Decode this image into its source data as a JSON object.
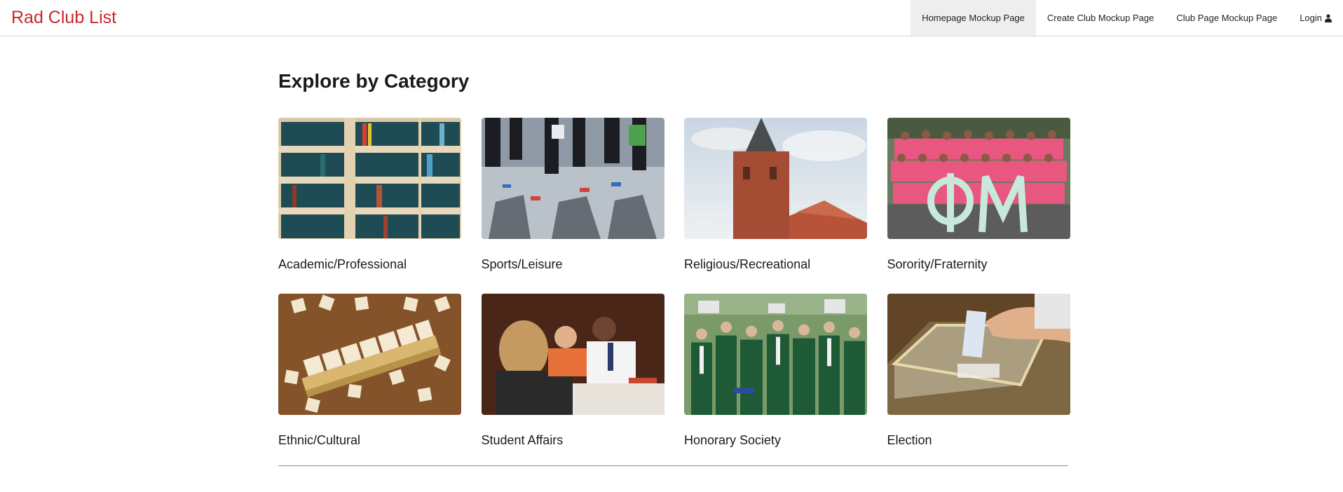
{
  "app": {
    "brand": "Rad Club List",
    "brand_color": "#c8282a"
  },
  "nav": {
    "items": [
      {
        "label": "Homepage Mockup Page",
        "active": true
      },
      {
        "label": "Create Club Mockup Page",
        "active": false
      },
      {
        "label": "Club Page Mockup Page",
        "active": false
      },
      {
        "label": "Login",
        "active": false,
        "icon": "user-icon"
      }
    ]
  },
  "main": {
    "title": "Explore by Category",
    "categories": [
      {
        "label": "Academic/Professional",
        "image": "bookshelf-photo"
      },
      {
        "label": "Sports/Leisure",
        "image": "runners-photo"
      },
      {
        "label": "Religious/Recreational",
        "image": "church-tower-photo"
      },
      {
        "label": "Sorority/Fraternity",
        "image": "sorority-group-photo"
      },
      {
        "label": "Ethnic/Cultural",
        "image": "scrabble-culture-photo"
      },
      {
        "label": "Student Affairs",
        "image": "meeting-photo"
      },
      {
        "label": "Honorary Society",
        "image": "graduation-photo"
      },
      {
        "label": "Election",
        "image": "ballot-box-photo"
      }
    ]
  }
}
